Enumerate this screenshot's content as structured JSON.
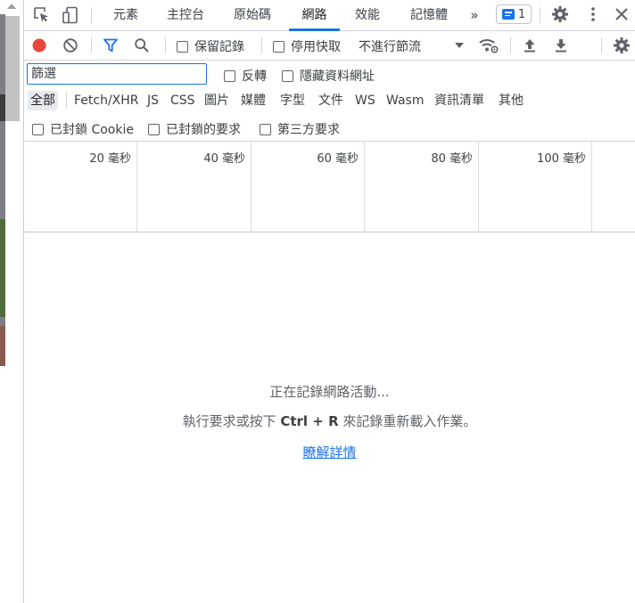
{
  "tabs": [
    "元素",
    "主控台",
    "原始碼",
    "網路",
    "效能",
    "記憶體"
  ],
  "active_tab": "網路",
  "more_tabs_glyph": "»",
  "issues_count": "1",
  "toolbar": {
    "preserve_log": "保留記錄",
    "disable_cache": "停用快取",
    "throttling": "不進行節流"
  },
  "filter": {
    "placeholder": "篩選",
    "value": "",
    "invert": "反轉",
    "hide_data_urls": "隱藏資料網址"
  },
  "types": [
    "全部",
    "Fetch/XHR",
    "JS",
    "CSS",
    "圖片",
    "媒體",
    "字型",
    "文件",
    "WS",
    "Wasm",
    "資訊清單",
    "其他"
  ],
  "active_type": "全部",
  "blocking": {
    "blocked_cookies": "已封鎖 Cookie",
    "blocked_requests": "已封鎖的要求",
    "third_party": "第三方要求"
  },
  "timeline_ticks": [
    "20 毫秒",
    "40 毫秒",
    "60 毫秒",
    "80 毫秒",
    "100 毫秒"
  ],
  "empty_state": {
    "recording": "正在記錄網路活動...",
    "hint_before": "執行要求或按下 ",
    "shortcut": "Ctrl + R",
    "hint_after": " 來記錄重新載入作業。",
    "learn_more": "瞭解詳情"
  },
  "colors": {
    "accent": "#1a73e8",
    "record": "#e8453c"
  },
  "icons": [
    "inspect-icon",
    "device-toggle-icon",
    "issues-icon",
    "settings-icon",
    "more-vertical-icon",
    "close-icon",
    "record-icon",
    "clear-icon",
    "filter-icon",
    "search-icon",
    "dropdown-icon",
    "network-conditions-icon",
    "import-har-icon",
    "export-har-icon",
    "network-settings-icon"
  ]
}
